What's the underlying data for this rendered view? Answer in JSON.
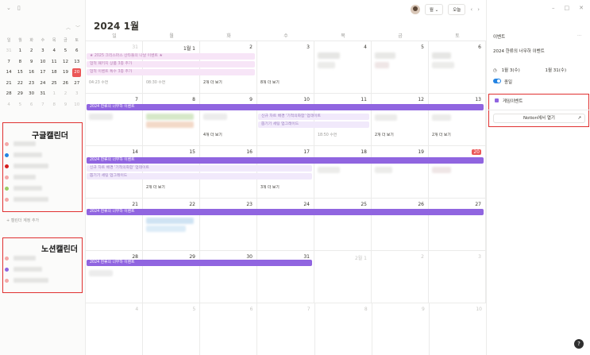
{
  "sidebar": {
    "weekday_headers": [
      "일",
      "월",
      "화",
      "수",
      "목",
      "금",
      "토"
    ],
    "mini_calendar": [
      [
        {
          "d": "31",
          "dim": true
        },
        {
          "d": "1"
        },
        {
          "d": "2"
        },
        {
          "d": "3"
        },
        {
          "d": "4"
        },
        {
          "d": "5"
        },
        {
          "d": "6"
        }
      ],
      [
        {
          "d": "7"
        },
        {
          "d": "8"
        },
        {
          "d": "9"
        },
        {
          "d": "10"
        },
        {
          "d": "11"
        },
        {
          "d": "12"
        },
        {
          "d": "13"
        }
      ],
      [
        {
          "d": "14"
        },
        {
          "d": "15"
        },
        {
          "d": "16"
        },
        {
          "d": "17"
        },
        {
          "d": "18"
        },
        {
          "d": "19"
        },
        {
          "d": "20",
          "today": true
        }
      ],
      [
        {
          "d": "21"
        },
        {
          "d": "22"
        },
        {
          "d": "23"
        },
        {
          "d": "24"
        },
        {
          "d": "25"
        },
        {
          "d": "26"
        },
        {
          "d": "27"
        }
      ],
      [
        {
          "d": "28"
        },
        {
          "d": "29"
        },
        {
          "d": "30"
        },
        {
          "d": "31"
        },
        {
          "d": "1",
          "dim": true
        },
        {
          "d": "2",
          "dim": true
        },
        {
          "d": "3",
          "dim": true
        }
      ],
      [
        {
          "d": "4",
          "dim": true
        },
        {
          "d": "5",
          "dim": true
        },
        {
          "d": "6",
          "dim": true
        },
        {
          "d": "7",
          "dim": true
        },
        {
          "d": "8",
          "dim": true
        },
        {
          "d": "9",
          "dim": true
        },
        {
          "d": "10",
          "dim": true
        }
      ]
    ],
    "google_label": "구글캘린더",
    "notion_label": "노션캘린더",
    "add_calendar": "+ 캘린더 계정 추가",
    "google_dots": [
      "#f4a8a8",
      "#2383e2",
      "#d61e1e",
      "#f4a8a8",
      "#9ccc65",
      "#f4a8a8"
    ],
    "notion_dots": [
      "#f4a8a8",
      "#9065e0",
      "#f4a8a8"
    ]
  },
  "toolbar": {
    "view_label": "월 ⌄",
    "today_label": "오늘",
    "prev": "‹",
    "next": "›"
  },
  "header": {
    "year": "2024",
    "month": "1월"
  },
  "weekdays": [
    "일",
    "월",
    "화",
    "수",
    "목",
    "금",
    "토"
  ],
  "weeks": [
    [
      "31",
      "1월 1",
      "2",
      "3",
      "4",
      "5",
      "6"
    ],
    [
      "7",
      "8",
      "9",
      "10",
      "11",
      "12",
      "13"
    ],
    [
      "14",
      "15",
      "16",
      "17",
      "18",
      "19",
      "20"
    ],
    [
      "21",
      "22",
      "23",
      "24",
      "25",
      "26",
      "27"
    ],
    [
      "28",
      "29",
      "30",
      "31",
      "2월 1",
      "2",
      "3"
    ],
    [
      "4",
      "5",
      "6",
      "7",
      "8",
      "9",
      "10"
    ]
  ],
  "events": {
    "xmas": "★ 2025 크리스마스 산타들의 나날 이벤트 ★",
    "pink1": "업적 패키지 상품 3종 추가",
    "pink2": "업적 이벤트 특수 3종 추가",
    "nuri": "2024 한류의 너무하 이벤트",
    "update": "신규 차트 배경 '기적의화합' 업데이트",
    "gacha": "뽑기기 세팅 업그레이드",
    "more2": "2개 더 보기",
    "more3": "3개 더 보기",
    "more4": "4개 더 보기",
    "more8": "8개 더 보기",
    "w1sun": "04:23 수면",
    "w1mon": "08:30 수면",
    "w2sun": "18:50 수면"
  },
  "panel": {
    "section": "이벤트",
    "title": "2024 한류의 너무하 이벤트",
    "start": "1월 3(수)",
    "end": "1월 31(수)",
    "allday": "종일",
    "calendar": "게임이벤트",
    "open_in_notion": "Notion에서 열기",
    "event_color": "#9065e0"
  }
}
